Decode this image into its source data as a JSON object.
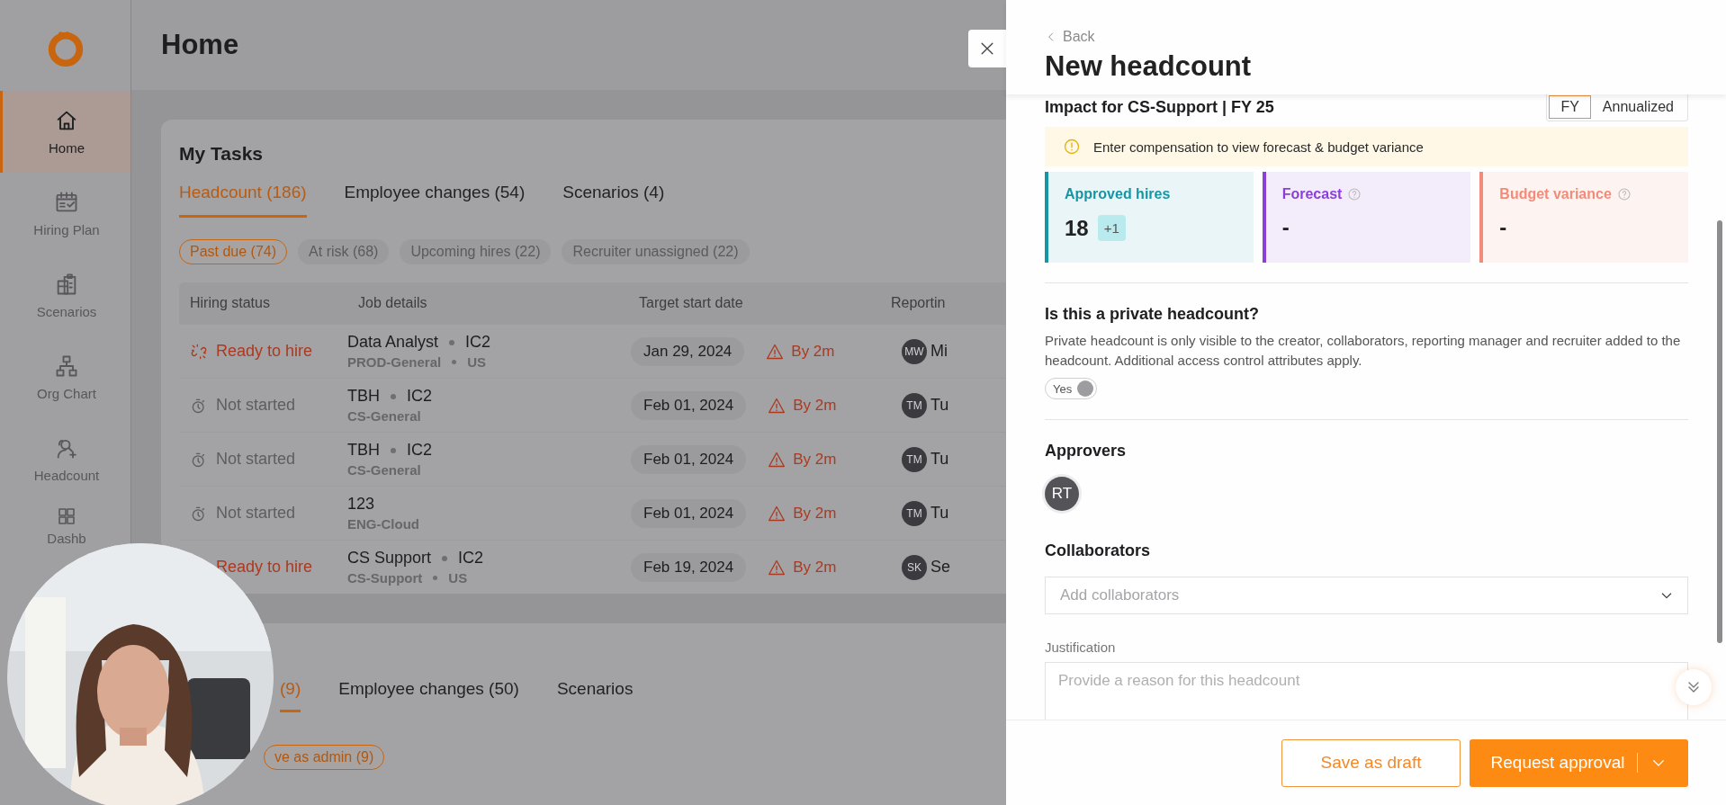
{
  "sidebar": {
    "items": [
      {
        "label": "Home",
        "selected": true
      },
      {
        "label": "Hiring Plan",
        "selected": false
      },
      {
        "label": "Scenarios",
        "selected": false
      },
      {
        "label": "Org Chart",
        "selected": false
      },
      {
        "label": "Headcount",
        "selected": false
      },
      {
        "label": "Dashb",
        "selected": false
      }
    ]
  },
  "header": {
    "title": "Home"
  },
  "tasks_card": {
    "title": "My Tasks",
    "tabs": [
      {
        "label": "Headcount (186)",
        "selected": true
      },
      {
        "label": "Employee changes (54)",
        "selected": false
      },
      {
        "label": "Scenarios (4)",
        "selected": false
      }
    ],
    "filters": [
      {
        "label": "Past due (74)",
        "selected": true
      },
      {
        "label": "At risk (68)",
        "selected": false
      },
      {
        "label": "Upcoming hires (22)",
        "selected": false
      },
      {
        "label": "Recruiter unassigned (22)",
        "selected": false
      }
    ],
    "table": {
      "columns": [
        "Hiring status",
        "Job details",
        "Target start date",
        "Reportin"
      ],
      "rows": [
        {
          "status": "Ready to hire",
          "kind": "ready",
          "status_icon": true,
          "title": "Data Analyst",
          "level": "IC2",
          "dept": "PROD-General",
          "location": "US",
          "date": "Jan 29, 2024",
          "due": "By 2m",
          "initials": "MW",
          "manager": "Mi"
        },
        {
          "status": "Not started",
          "kind": "not_started",
          "status_icon": true,
          "title": "TBH",
          "level": "IC2",
          "dept": "CS-General",
          "date": "Feb 01, 2024",
          "due": "By 2m",
          "initials": "TM",
          "manager": "Tu"
        },
        {
          "status": "Not started",
          "kind": "not_started",
          "status_icon": true,
          "title": "TBH",
          "level": "IC2",
          "dept": "CS-General",
          "date": "Feb 01, 2024",
          "due": "By 2m",
          "initials": "TM",
          "manager": "Tu"
        },
        {
          "status": "Not started",
          "kind": "not_started",
          "status_icon": true,
          "title": "123",
          "dept": "ENG-Cloud",
          "date": "Feb 01, 2024",
          "due": "By 2m",
          "initials": "TM",
          "manager": "Tu"
        },
        {
          "status": "Ready to hire",
          "kind": "ready",
          "status_icon": false,
          "title": "CS Support",
          "level": "IC2",
          "dept": "CS-Support",
          "location": "US",
          "date": "Feb 19, 2024",
          "due": "By 2m",
          "initials": "SK",
          "manager": "Se"
        }
      ]
    }
  },
  "second_card": {
    "tabs": [
      {
        "label": "(9)",
        "selected": true
      },
      {
        "label": "Employee changes (50)",
        "selected": false
      },
      {
        "label": "Scenarios",
        "selected": false
      }
    ],
    "filters": [
      {
        "label": "ve as admin (9)",
        "selected": true
      }
    ]
  },
  "drawer": {
    "back": "Back",
    "title": "New headcount",
    "impact": {
      "title": "Impact for CS-Support | FY 25",
      "periods": [
        {
          "label": "FY",
          "selected": true
        },
        {
          "label": "Annualized",
          "selected": false
        }
      ]
    },
    "notice": "Enter compensation to view forecast & budget variance",
    "stats": [
      {
        "label": "Approved hires",
        "value": "18",
        "delta": "+1",
        "color": "#1596a6",
        "help": false
      },
      {
        "label": "Forecast",
        "value": "-",
        "color": "#8a3fd9",
        "help": true
      },
      {
        "label": "Budget variance",
        "value": "-",
        "color": "#f38b7b",
        "help": true
      }
    ],
    "private": {
      "question": "Is this a private headcount?",
      "description": "Private headcount is only visible to the creator, collaborators, reporting manager and recruiter added to the headcount. Additional access control attributes apply.",
      "toggle": {
        "label": "Yes",
        "on": true
      }
    },
    "approvers": {
      "title": "Approvers",
      "people": [
        "RT"
      ]
    },
    "collaborators": {
      "title": "Collaborators",
      "placeholder": "Add collaborators"
    },
    "justification": {
      "label": "Justification",
      "placeholder": "Provide a reason for this headcount"
    },
    "buttons": [
      {
        "label": "Save as draft",
        "kind": "secondary"
      },
      {
        "label": "Request approval",
        "kind": "primary"
      }
    ]
  }
}
